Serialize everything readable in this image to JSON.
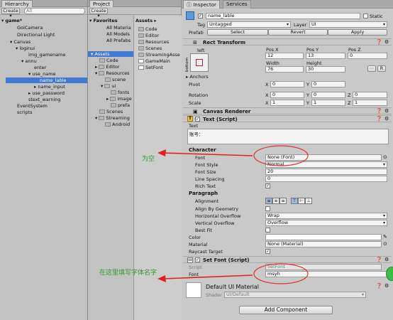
{
  "hierarchy": {
    "tab": "Hierarchy",
    "create": "Create ▾",
    "search": "All",
    "scene": "game*",
    "items": [
      "GoiCamera",
      "Directional Light",
      "Canvas",
      "loginui",
      "img_gamename",
      "annu",
      "enter",
      "use_name",
      "name_lable",
      "name_input",
      "use_password",
      "stext_warning",
      "EventSystem",
      "scripts"
    ]
  },
  "project": {
    "tab": "Project",
    "create": "Create ▾",
    "favorites": "Favorites",
    "fav_items": [
      "All Materia",
      "All Models",
      "All Prefabs"
    ],
    "assets": "Assets",
    "tree": [
      "Code",
      "Editor",
      "Resources",
      "scene",
      "ui",
      "fonts",
      "image",
      "prefa",
      "Scenes",
      "Streaming",
      "Android"
    ],
    "files_header": "Assets ▸",
    "files": [
      "Code",
      "Editor",
      "Resources",
      "Scenes",
      "StreamingAsse",
      "GameMain",
      "SetFont"
    ]
  },
  "inspector": {
    "tab": "Inspector",
    "tab2": "Services",
    "object_name": "name_lable",
    "static": "Static",
    "tag_label": "Tag",
    "tag_value": "Untagged",
    "layer_label": "Layer",
    "layer_value": "UI",
    "prefab_label": "Prefab",
    "prefab_select": "Select",
    "prefab_revert": "Revert",
    "prefab_apply": "Apply",
    "rect_transform": "Rect Transform",
    "anchor_side": "left",
    "anchor_vert": "bottom",
    "pos_x_label": "Pos X",
    "pos_y_label": "Pos Y",
    "pos_z_label": "Pos Z",
    "pos_x": "12",
    "pos_y": "13",
    "pos_z": "0",
    "width_label": "Width",
    "height_label": "Height",
    "width": "76",
    "height": "30",
    "anchors": "Anchors",
    "pivot": "Pivot",
    "pivot_x": "0",
    "pivot_y": "0",
    "rotation": "Rotation",
    "rot_x": "0",
    "rot_y": "0",
    "rot_z": "0",
    "scale": "Scale",
    "scale_x": "1",
    "scale_y": "1",
    "scale_z": "1",
    "canvas_renderer": "Canvas Renderer",
    "text_script": "Text (Script)",
    "text_label": "Text",
    "text_value": "账号：",
    "character": "Character",
    "font_label": "Font",
    "font_value": "None (Font)",
    "font_style_label": "Font Style",
    "font_style_value": "Normal",
    "font_size_label": "Font Size",
    "font_size_value": "20",
    "line_spacing_label": "Line Spacing",
    "line_spacing_value": "0",
    "rich_text_label": "Rich Text",
    "paragraph": "Paragraph",
    "alignment_label": "Alignment",
    "align_by_geometry": "Align By Geometry",
    "h_overflow_label": "Horizontal Overflow",
    "h_overflow_value": "Wrap",
    "v_overflow_label": "Vertical Overflow",
    "v_overflow_value": "Overflow",
    "best_fit": "Best Fit",
    "color_label": "Color",
    "material_label": "Material",
    "material_value": "None (Material)",
    "raycast_label": "Raycast Target",
    "set_font_script": "Set Font (Script)",
    "script_label": "Script",
    "script_value": "SetFont",
    "font2_label": "Font",
    "font2_value": "msyh",
    "default_material": "Default UI Material",
    "shader_label": "Shader",
    "shader_value": "UI/Default",
    "add_component": "Add Component"
  },
  "annotations": {
    "note1": "为空",
    "note2": "在这里填写字体名字"
  },
  "colors": {
    "selection": "#3e7ad6",
    "annotation_text": "#2f9a2f",
    "arrow": "#e02020",
    "ellipse": "#e03030"
  }
}
